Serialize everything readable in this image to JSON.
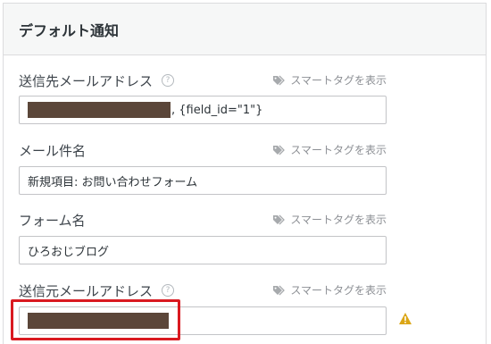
{
  "panel": {
    "title": "デフォルト通知"
  },
  "smart_tag_label": "スマートタグを表示",
  "fields": [
    {
      "label": "送信先メールアドレス",
      "help": "?",
      "value_suffix": ", {field_id=\"1\"}"
    },
    {
      "label": "メール件名",
      "value": "新規項目: お問い合わせフォーム"
    },
    {
      "label": "フォーム名",
      "value": "ひろおじブログ"
    },
    {
      "label": "送信元メールアドレス",
      "help": "?"
    }
  ],
  "icons": {
    "help": "question-circle-icon",
    "smart_tag": "tag-icon",
    "warning": "warning-triangle-icon"
  },
  "colors": {
    "highlight_border": "#d91920",
    "warning": "#dba617",
    "redaction": "#5b4639"
  }
}
